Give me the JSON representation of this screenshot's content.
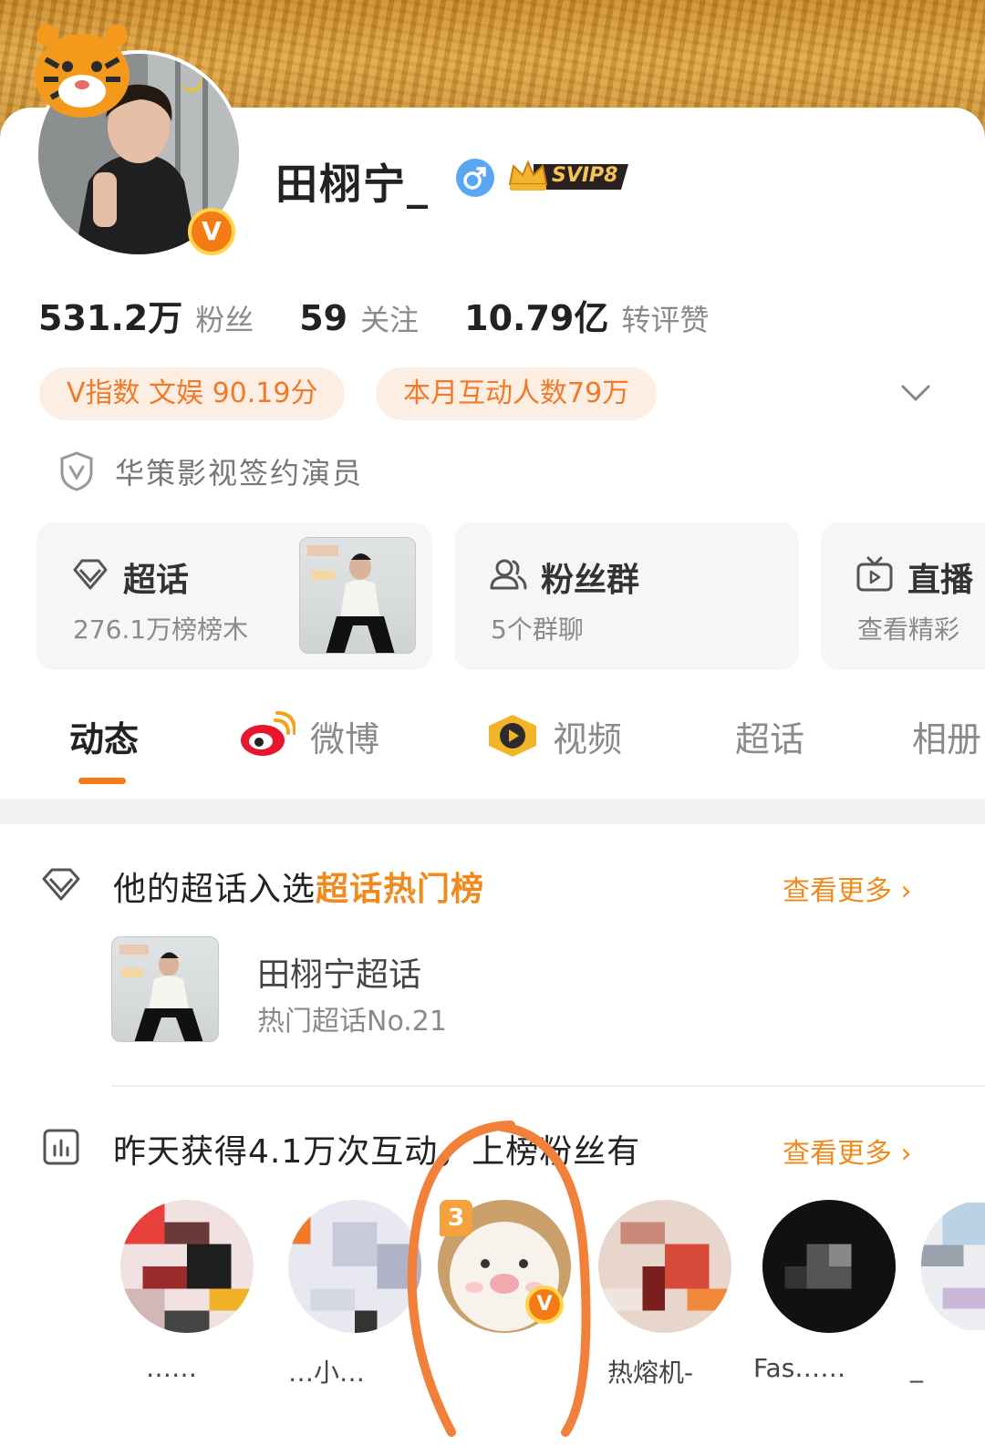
{
  "profile": {
    "name": "田栩宁_",
    "vip_badge": "SVIP8",
    "verified_mark": "V",
    "stats": [
      {
        "value": "531.2万",
        "label": "粉丝"
      },
      {
        "value": "59",
        "label": "关注"
      },
      {
        "value": "10.79亿",
        "label": "转评赞"
      }
    ],
    "pills": [
      "V指数 文娱 90.19分",
      "本月互动人数79万"
    ],
    "certification": "华策影视签约演员"
  },
  "tiles": [
    {
      "title": "超话",
      "subtitle": "276.1万榜榜木",
      "icon": "diamond-icon"
    },
    {
      "title": "粉丝群",
      "subtitle": "5个群聊",
      "icon": "group-icon"
    },
    {
      "title": "直播",
      "subtitle": "查看精彩",
      "icon": "tv-icon"
    }
  ],
  "tabs": [
    "动态",
    "微博",
    "视频",
    "超话",
    "相册"
  ],
  "supertopic_section": {
    "title_prefix": "他的超话入选",
    "title_highlight": "超话热门榜",
    "more": "查看更多",
    "topic_name": "田栩宁超话",
    "topic_rank": "热门超话No.21"
  },
  "fans_section": {
    "title": "昨天获得4.1万次互动，上榜粉丝有",
    "more": "查看更多",
    "fans": [
      {
        "name": "……"
      },
      {
        "name": "…小…"
      },
      {
        "name": "",
        "rank": "3"
      },
      {
        "name": "热熔机-"
      },
      {
        "name": "Fas……"
      },
      {
        "name": "_"
      }
    ]
  },
  "colors": {
    "accent": "#f47b13",
    "pill_bg": "#fdeee3",
    "link": "#f08a1c"
  }
}
